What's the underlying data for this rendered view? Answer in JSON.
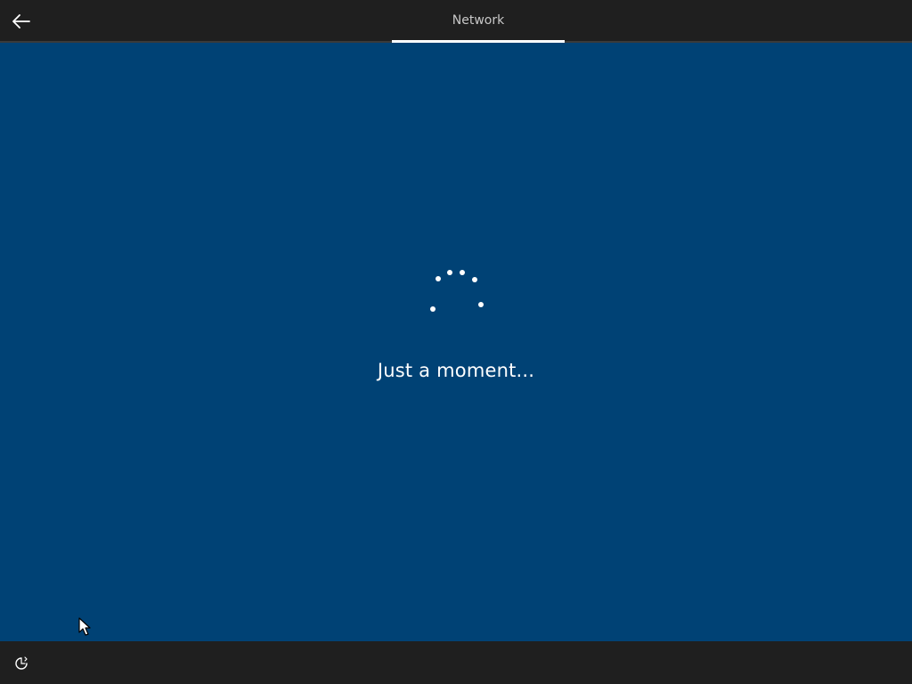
{
  "header": {
    "back_icon": "back-arrow-icon",
    "tab_title": "Network"
  },
  "main": {
    "spinner_icon": "loading-dots-icon",
    "status_text": "Just a moment..."
  },
  "footer": {
    "ease_of_access_icon": "ease-of-access-icon"
  },
  "colors": {
    "background": "#004275",
    "bar": "#1f1f1f",
    "text": "#ffffff"
  }
}
